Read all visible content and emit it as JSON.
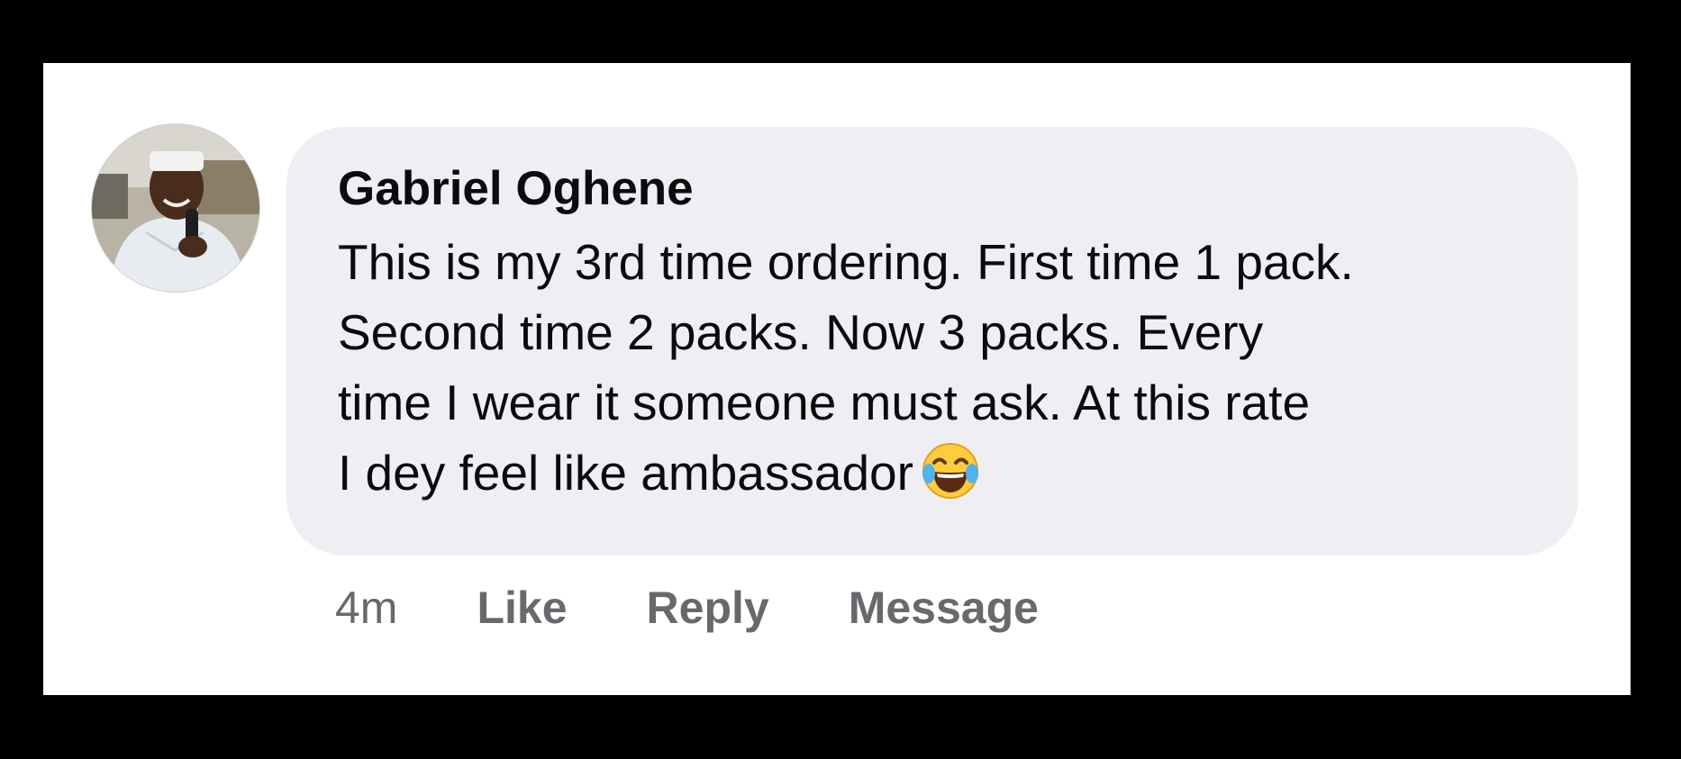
{
  "comment": {
    "author": "Gabriel Oghene",
    "lines": [
      "This is my 3rd time ordering. First time 1 pack.",
      "Second time 2 packs. Now 3 packs. Every",
      "time I wear it someone must ask. At this rate",
      "I dey feel like ambassador"
    ],
    "emoji": "face-with-tears-of-joy-icon",
    "timestamp": "4m",
    "actions": {
      "like": "Like",
      "reply": "Reply",
      "message": "Message"
    }
  },
  "colors": {
    "bubble": "#efeff3",
    "text": "#0b0b0d",
    "action_text": "#67696d",
    "frame": "#000000",
    "card": "#ffffff"
  }
}
